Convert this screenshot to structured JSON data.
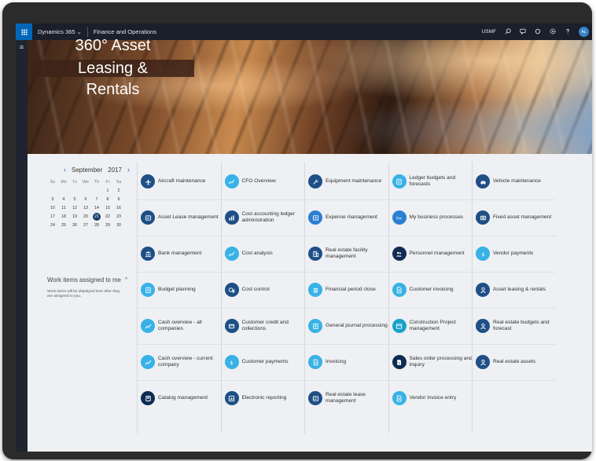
{
  "navbar": {
    "brand": "Dynamics 365",
    "brand_chevron": "⌄",
    "module": "Finance and Operations",
    "company": "USMF",
    "avatar": "AL",
    "icons": [
      "search-icon",
      "chat-icon",
      "settings-icon",
      "help-icon"
    ]
  },
  "app_title": {
    "line1": "360° Asset",
    "line2": "Leasing &",
    "line3": "Rentals"
  },
  "calendar": {
    "month": "September",
    "year": "2017",
    "prev": "‹",
    "next": "›",
    "weekdays": [
      "Su",
      "Mo",
      "Tu",
      "We",
      "Th",
      "Fr",
      "Sa"
    ],
    "weeks": [
      [
        "",
        "",
        "",
        "",
        "",
        "1",
        "2"
      ],
      [
        "3",
        "4",
        "5",
        "6",
        "7",
        "8",
        "9"
      ],
      [
        "10",
        "11",
        "12",
        "13",
        "14",
        "15",
        "16"
      ],
      [
        "17",
        "18",
        "19",
        "20",
        "21",
        "22",
        "23"
      ],
      [
        "24",
        "25",
        "26",
        "27",
        "28",
        "29",
        "30"
      ]
    ],
    "today": "21"
  },
  "work_items": {
    "title": "Work items assigned to me",
    "chevron": "^",
    "body": "Work items will be displayed here after they are assigned to you."
  },
  "colors": {
    "navy": "#1e4f86",
    "blue": "#2b7fd1",
    "cyan": "#38b2e6",
    "dark": "#0e2b52"
  },
  "tile_columns": [
    [
      {
        "label": "Aircraft maintenance",
        "color": "#1e4f86",
        "icon": "aircraft-icon"
      },
      {
        "label": "Asset Lease management",
        "color": "#1e4f86",
        "icon": "lease-icon"
      },
      {
        "label": "Bank management",
        "color": "#1e4f86",
        "icon": "bank-icon"
      },
      {
        "label": "Budget planning",
        "color": "#38b2e6",
        "icon": "budget-icon"
      },
      {
        "label": "Cash overview - all companies",
        "color": "#38b2e6",
        "icon": "chart-icon"
      },
      {
        "label": "Cash overview - current company",
        "color": "#38b2e6",
        "icon": "chart-icon"
      },
      {
        "label": "Catalog management",
        "color": "#0e2b52",
        "icon": "catalog-icon"
      }
    ],
    [
      {
        "label": "CFO Overview",
        "color": "#38b2e6",
        "icon": "chart-icon"
      },
      {
        "label": "Cost accounting ledger administration",
        "color": "#1e4f86",
        "icon": "ledger-icon"
      },
      {
        "label": "Cost analysis",
        "color": "#38b2e6",
        "icon": "chart-icon"
      },
      {
        "label": "Cost control",
        "color": "#1e4f86",
        "icon": "control-icon"
      },
      {
        "label": "Customer credit and collections",
        "color": "#1e4f86",
        "icon": "credit-icon"
      },
      {
        "label": "Customer payments",
        "color": "#38b2e6",
        "icon": "payment-icon"
      },
      {
        "label": "Electronic reporting",
        "color": "#1e4f86",
        "icon": "report-icon"
      }
    ],
    [
      {
        "label": "Equipment maintenance",
        "color": "#1e4f86",
        "icon": "equipment-icon"
      },
      {
        "label": "Expense management",
        "color": "#2b7fd1",
        "icon": "expense-icon"
      },
      {
        "label": "Real estate facility management",
        "color": "#1e4f86",
        "icon": "building-icon"
      },
      {
        "label": "Financial period close",
        "color": "#38b2e6",
        "icon": "list-icon"
      },
      {
        "label": "General journal processing",
        "color": "#38b2e6",
        "icon": "journal-icon"
      },
      {
        "label": "Invoicing",
        "color": "#38b2e6",
        "icon": "document-icon"
      },
      {
        "label": "Real estate lease management",
        "color": "#1e4f86",
        "icon": "lease-icon"
      }
    ],
    [
      {
        "label": "Ledger budgets and forecasts",
        "color": "#38b2e6",
        "icon": "budget-icon"
      },
      {
        "label": "My business processes",
        "color": "#2b7fd1",
        "icon": "process-icon"
      },
      {
        "label": "Personnel management",
        "color": "#0e2b52",
        "icon": "people-icon"
      },
      {
        "label": "Customer invoicing",
        "color": "#38b2e6",
        "icon": "document-icon"
      },
      {
        "label": "Construction Project management",
        "color": "#1aa3c8",
        "icon": "project-icon"
      },
      {
        "label": "Sales order processing and inquiry",
        "color": "#0e2b52",
        "icon": "sales-icon"
      },
      {
        "label": "Vendor invoice entry",
        "color": "#38b2e6",
        "icon": "document-icon"
      }
    ],
    [
      {
        "label": "Vehicle maintenance",
        "color": "#1e4f86",
        "icon": "vehicle-icon"
      },
      {
        "label": "Fixed asset management",
        "color": "#1e4f86",
        "icon": "asset-icon"
      },
      {
        "label": "Vendor payments",
        "color": "#38b2e6",
        "icon": "payment-icon"
      },
      {
        "label": "Asset leasing & rentals",
        "color": "#1e4f86",
        "icon": "person-icon"
      },
      {
        "label": "Real estate budgets and forecast",
        "color": "#1e4f86",
        "icon": "person-icon"
      },
      {
        "label": "Real estate assets",
        "color": "#1e4f86",
        "icon": "person-icon"
      }
    ]
  ]
}
